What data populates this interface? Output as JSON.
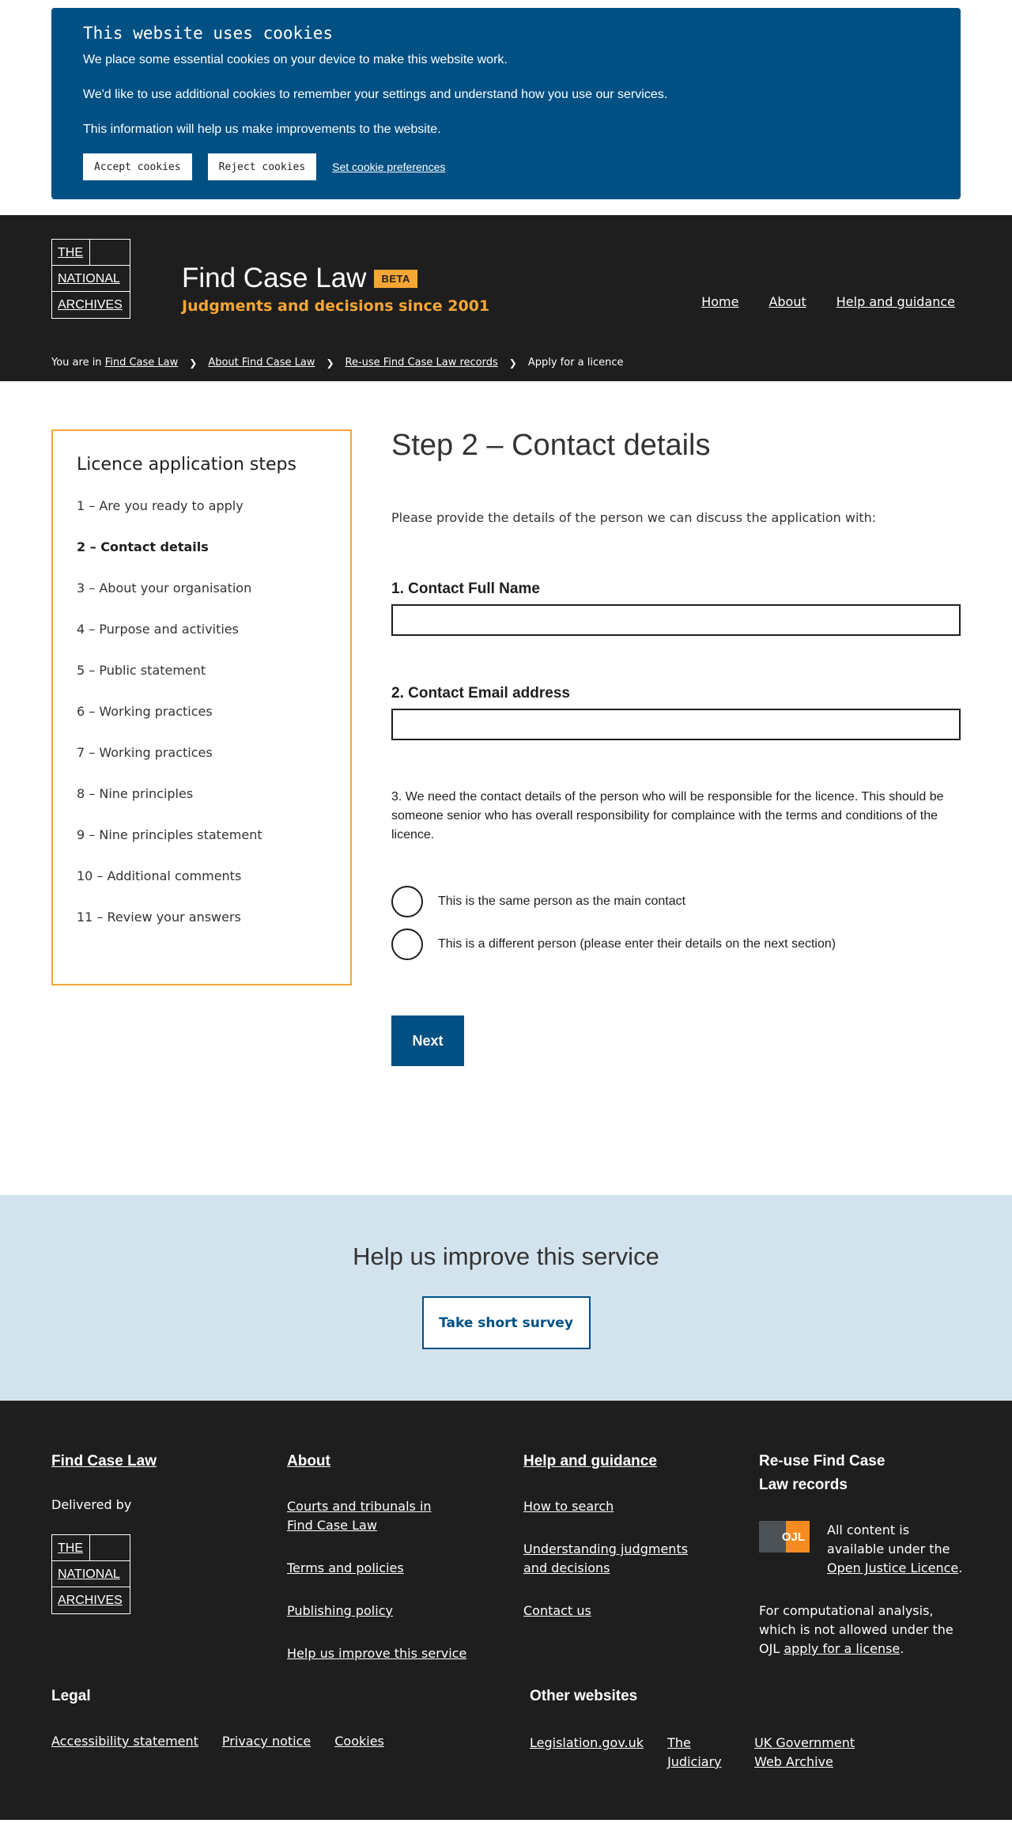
{
  "cookie": {
    "title": "This website uses cookies",
    "p1": "We place some essential cookies on your device to make this website work.",
    "p2": "We'd like to use additional cookies to remember your settings and understand how you use our services.",
    "p3": "This information will help us make improvements to the website.",
    "accept": "Accept cookies",
    "reject": "Reject cookies",
    "preferences": "Set cookie preferences"
  },
  "logo": {
    "line1": "THE",
    "line2": "NATIONAL",
    "line3": "ARCHIVES"
  },
  "header": {
    "title": "Find Case Law",
    "beta": "BETA",
    "tagline": "Judgments and decisions since 2001",
    "nav": [
      "Home",
      "About",
      "Help and guidance"
    ]
  },
  "breadcrumb": {
    "prefix": "You are in",
    "items": [
      "Find Case Law",
      "About Find Case Law",
      "Re-use Find Case Law records"
    ],
    "current": "Apply for a licence"
  },
  "steps": {
    "title": "Licence application steps",
    "items": [
      "1 – Are you ready to apply",
      "2 – Contact details",
      "3 – About your organisation",
      "4 – Purpose and activities",
      "5 – Public statement",
      "6 – Working practices",
      "7 – Working practices",
      "8 – Nine principles",
      "9 – Nine principles statement",
      "10 – Additional comments",
      "11 – Review your answers"
    ]
  },
  "form": {
    "heading": "Step 2 – Contact details",
    "intro": "Please provide the details of the person we can discuss the application with:",
    "q1": "1. Contact Full Name",
    "q1_value": "",
    "q2": "2. Contact Email address",
    "q2_value": "",
    "q3": "3. We need the contact details of the person who will be responsible for the licence. This should be someone senior who has overall responsibility for complaince with the terms and conditions of the licence.",
    "radio1": "This is the same person as the main contact",
    "radio2": "This is a different person (please enter their details on the next section)",
    "next": "Next"
  },
  "survey": {
    "title": "Help us improve this service",
    "button": "Take short survey"
  },
  "footer": {
    "col1_title": "Find Case Law",
    "delivered_by": "Delivered by",
    "col2_title": "About",
    "col2_links": [
      "Courts and tribunals in Find Case Law",
      "Terms and policies",
      "Publishing policy",
      "Help us improve this service"
    ],
    "col3_title": "Help and guidance",
    "col3_links": [
      "How to search",
      "Understanding judgments and decisions",
      "Contact us"
    ],
    "col4_title": "Re-use Find Case Law records",
    "ojl_badge": "OJL",
    "ojl_text": "All content is available under the",
    "ojl_link": "Open Justice Licence",
    "comp_text": "For computational analysis, which is not allowed under the OJL",
    "comp_link": "apply for a license",
    "legal_title": "Legal",
    "legal_links": [
      "Accessibility statement",
      "Privacy notice",
      "Cookies"
    ],
    "other_title": "Other websites",
    "other_links": [
      "Legislation.gov.uk",
      "The Judiciary",
      "UK Government Web Archive"
    ]
  }
}
